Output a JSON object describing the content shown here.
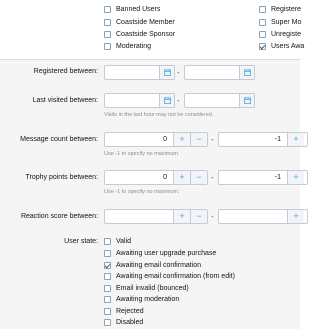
{
  "user_groups": {
    "col1": [
      {
        "label": "Banned Users",
        "checked": false
      },
      {
        "label": "Coastside Member",
        "checked": false
      },
      {
        "label": "Coastside Sponsor",
        "checked": false
      },
      {
        "label": "Moderating",
        "checked": false
      }
    ],
    "col2": [
      {
        "label": "Registere",
        "checked": false
      },
      {
        "label": "Super Mo",
        "checked": false
      },
      {
        "label": "Unregiste",
        "checked": false
      },
      {
        "label": "Users Awa",
        "checked": true
      }
    ]
  },
  "registered_between": {
    "label": "Registered between:",
    "from": "",
    "to": "",
    "separator": "-"
  },
  "last_visited_between": {
    "label": "Last visited between:",
    "from": "",
    "to": "",
    "separator": "-",
    "hint": "Visits in the last hour may not be considered."
  },
  "message_count_between": {
    "label": "Message count between:",
    "min": "0",
    "max": "-1",
    "separator": "-",
    "hint": "Use -1 to specify no maximum."
  },
  "trophy_points_between": {
    "label": "Trophy points between:",
    "min": "0",
    "max": "-1",
    "separator": "-",
    "hint": "Use -1 to specify no maximum."
  },
  "reaction_score_between": {
    "label": "Reaction score between:",
    "min": "",
    "max": "",
    "separator": "-"
  },
  "user_state": {
    "label": "User state:",
    "options": [
      {
        "label": "Valid",
        "checked": false
      },
      {
        "label": "Awaiting user upgrade purchase",
        "checked": false
      },
      {
        "label": "Awaiting email confirmation",
        "checked": true
      },
      {
        "label": "Awaiting email confirmation (from edit)",
        "checked": false
      },
      {
        "label": "Email invalid (bounced)",
        "checked": false
      },
      {
        "label": "Awaiting moderation",
        "checked": false
      },
      {
        "label": "Rejected",
        "checked": false
      },
      {
        "label": "Disabled",
        "checked": false
      }
    ]
  },
  "steppers": {
    "plus": "+",
    "minus": "−"
  },
  "icons": {
    "calendar": "calendar-icon"
  },
  "colors": {
    "accent": "#47a7eb",
    "border": "#c4cbd4",
    "panel": "#f5f5f5",
    "checkmark": "#2b5f93"
  }
}
